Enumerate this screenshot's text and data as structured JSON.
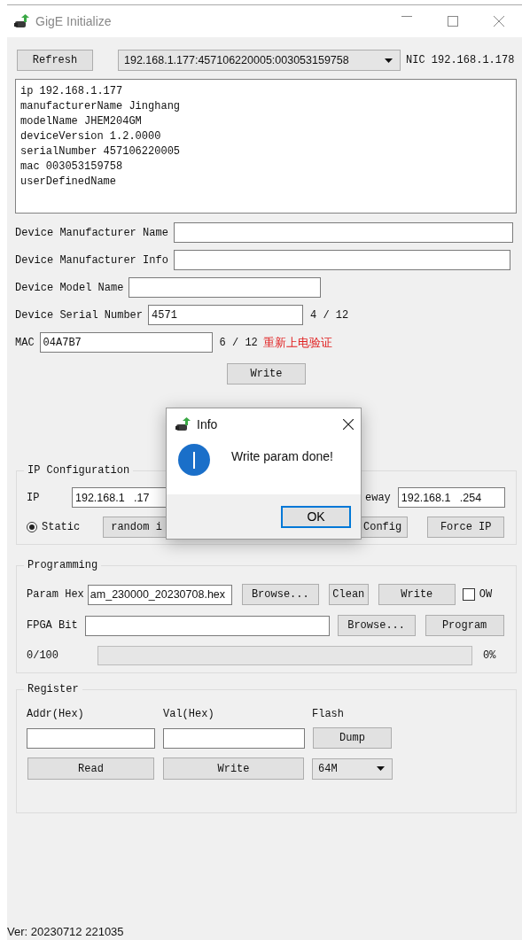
{
  "window": {
    "title": "GigE Initialize"
  },
  "toolbar": {
    "refresh_button": "Refresh",
    "device_select": "192.168.1.177:457106220005:003053159758",
    "nic_label": "NIC 192.168.1.178"
  },
  "device_info": [
    "ip 192.168.1.177",
    "manufacturerName Jinghang",
    "modelName JHEM204GM",
    "deviceVersion 1.2.0000",
    "serialNumber 457106220005",
    "mac 003053159758",
    "userDefinedName"
  ],
  "fields": [
    {
      "label": "Device Manufacturer Name"
    },
    {
      "label": "Device Manufacturer Info"
    },
    {
      "label": "Device Model Name"
    },
    {
      "label": "Device Serial Number",
      "value": "4571",
      "count": "4 / 12"
    },
    {
      "label": "MAC",
      "value": "04A7B7",
      "count": "6 / 12",
      "note": "重新上电验证"
    }
  ],
  "write_button": "Write",
  "ip_configuration": {
    "title": "IP Configuration",
    "ip_label": "IP",
    "ip_value": "192.168.1   .17",
    "gateway_label": "eway",
    "gateway_value": "192.168.1   .254",
    "static_radio": {
      "label": "Static",
      "selected": true
    },
    "random_button": "random i",
    "config_button": "Config",
    "force_button": "Force IP"
  },
  "programming": {
    "title": "Programming",
    "param_hex": {
      "label": "Param Hex",
      "value": "am_230000_20230708.hex"
    },
    "param_buttons": [
      "Browse...",
      "Clean",
      "Write"
    ],
    "ow": {
      "label": "OW",
      "checked": false
    },
    "fpga_bit": {
      "label": "FPGA Bit"
    },
    "fpga_buttons": [
      "Browse...",
      "Program"
    ],
    "progress": {
      "label": "0/100",
      "level": 0,
      "reading": "0%"
    }
  },
  "register": {
    "title": "Register",
    "addr_label": "Addr(Hex)",
    "val_label": "Val(Hex)",
    "flash_label": "Flash",
    "dump_button": "Dump",
    "read_button": "Read",
    "write_button": "Write",
    "flash_select": "64M"
  },
  "dialog": {
    "title": "Info",
    "message": "Write param done!",
    "ok_button": "OK"
  },
  "status_bar": {
    "version": "Ver: 20230712 221035"
  }
}
